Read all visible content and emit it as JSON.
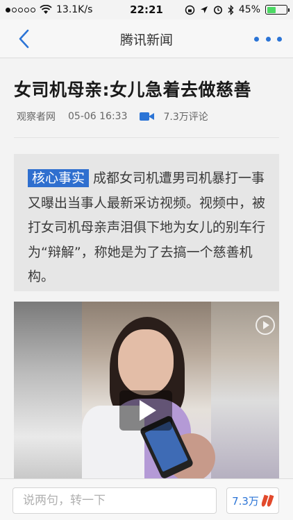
{
  "status_bar": {
    "network_speed": "13.1K/s",
    "time": "22:21",
    "battery_percent": "45%",
    "battery_level": 0.45,
    "signal_bars_filled": 1,
    "signal_bars_total": 5
  },
  "nav": {
    "title": "腾讯新闻",
    "back_icon": "chevron-left-icon",
    "more_icon": "more-dots-icon",
    "accent_color": "#2b74d6"
  },
  "article": {
    "headline": "女司机母亲:女儿急着去做慈善",
    "source": "观察者网",
    "timestamp": "05-06 16:33",
    "comment_count": "7.3万评论",
    "summary_tag": "核心事实",
    "summary_text": "成都女司机遭男司机暴打一事又曝出当事人最新采访视频。视频中，被打女司机母亲声泪俱下地为女儿的别车行为“辩解”，称她是为了去搞一个慈善机构。"
  },
  "bottom_bar": {
    "comment_placeholder": "说两句，转一下",
    "comment_count_short": "7.3万",
    "pepper_icon": "hot-pepper-icon"
  }
}
